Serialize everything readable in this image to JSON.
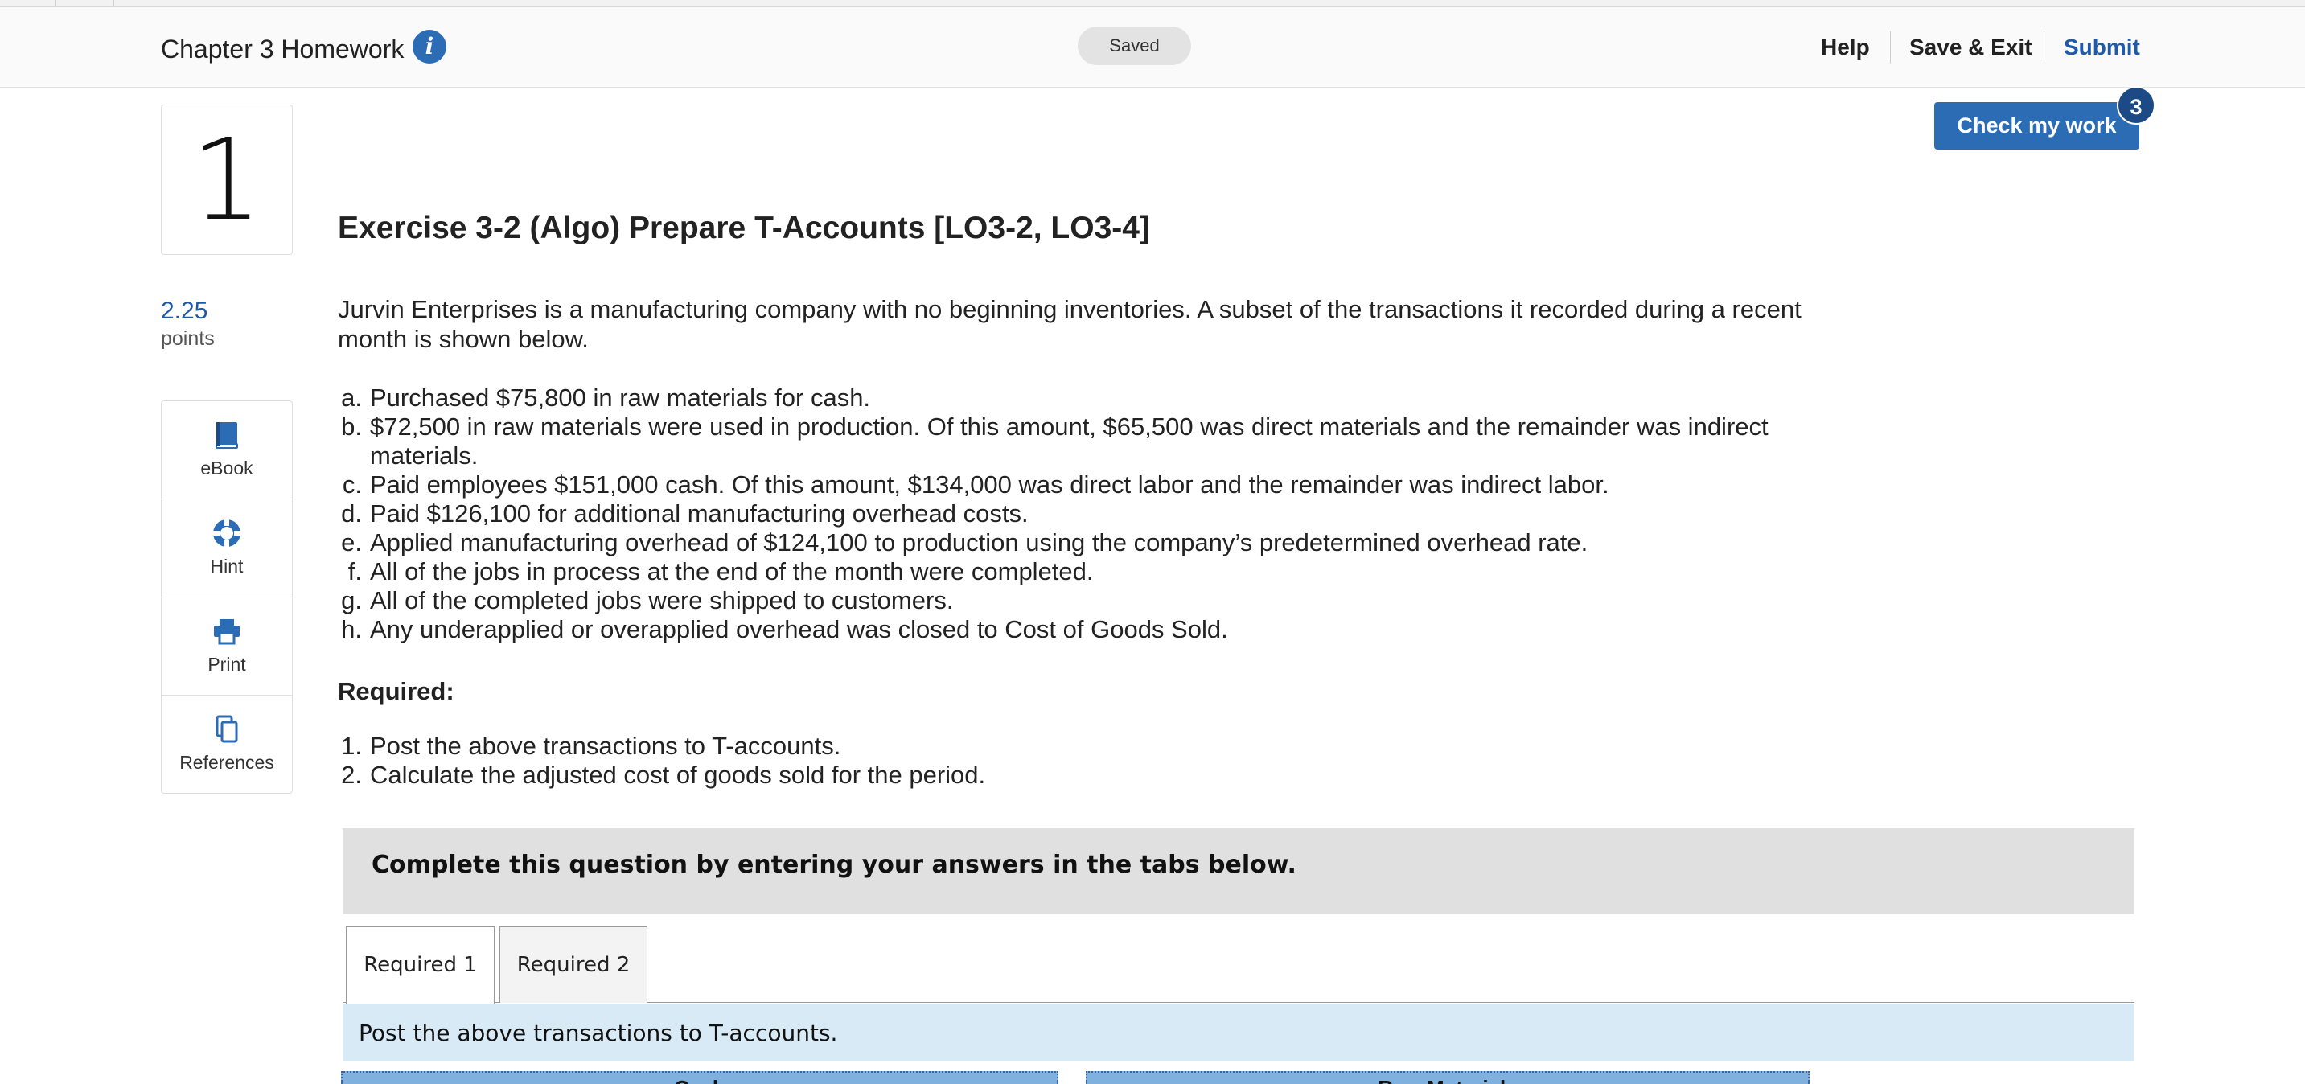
{
  "header": {
    "title": "Chapter 3 Homework",
    "info_glyph": "i",
    "status": "Saved",
    "links": {
      "help": "Help",
      "save_exit": "Save & Exit",
      "submit": "Submit"
    }
  },
  "question": {
    "number": "1",
    "points_value": "2.25",
    "points_label": "points",
    "check_button": "Check my work",
    "check_badge": "3"
  },
  "tools": [
    {
      "label": "eBook",
      "icon": "book-icon"
    },
    {
      "label": "Hint",
      "icon": "lifebuoy-icon"
    },
    {
      "label": "Print",
      "icon": "printer-icon"
    },
    {
      "label": "References",
      "icon": "documents-icon"
    }
  ],
  "exercise": {
    "title": "Exercise 3-2 (Algo) Prepare T-Accounts [LO3-2, LO3-4]",
    "intro": "Jurvin Enterprises is a manufacturing company with no beginning inventories. A subset of the transactions it recorded during a recent month is shown below.",
    "transactions": [
      {
        "marker": "a.",
        "text": "Purchased $75,800 in raw materials for cash."
      },
      {
        "marker": "b.",
        "text": "$72,500 in raw materials were used in production. Of this amount, $65,500 was direct materials and the remainder was indirect materials."
      },
      {
        "marker": "c.",
        "text": "Paid employees $151,000 cash. Of this amount, $134,000 was direct labor and the remainder was indirect labor."
      },
      {
        "marker": "d.",
        "text": "Paid $126,100 for additional manufacturing overhead costs."
      },
      {
        "marker": "e.",
        "text": "Applied manufacturing overhead of $124,100 to production using the company’s predetermined overhead rate."
      },
      {
        "marker": "f.",
        "text": "All of the jobs in process at the end of the month were completed."
      },
      {
        "marker": "g.",
        "text": "All of the completed jobs were shipped to customers."
      },
      {
        "marker": "h.",
        "text": "Any underapplied or overapplied overhead was closed to Cost of Goods Sold."
      }
    ],
    "required_heading": "Required:",
    "requirements": [
      {
        "marker": "1.",
        "text": "Post the above transactions to T-accounts."
      },
      {
        "marker": "2.",
        "text": "Calculate the adjusted cost of goods sold for the period."
      }
    ]
  },
  "answer_area": {
    "instruction": "Complete this question by entering your answers in the tabs below.",
    "tabs": [
      "Required 1",
      "Required 2"
    ],
    "active_tab_instruction": "Post the above transactions to T-accounts.",
    "t_accounts": [
      "Cash",
      "Raw Materials"
    ]
  }
}
